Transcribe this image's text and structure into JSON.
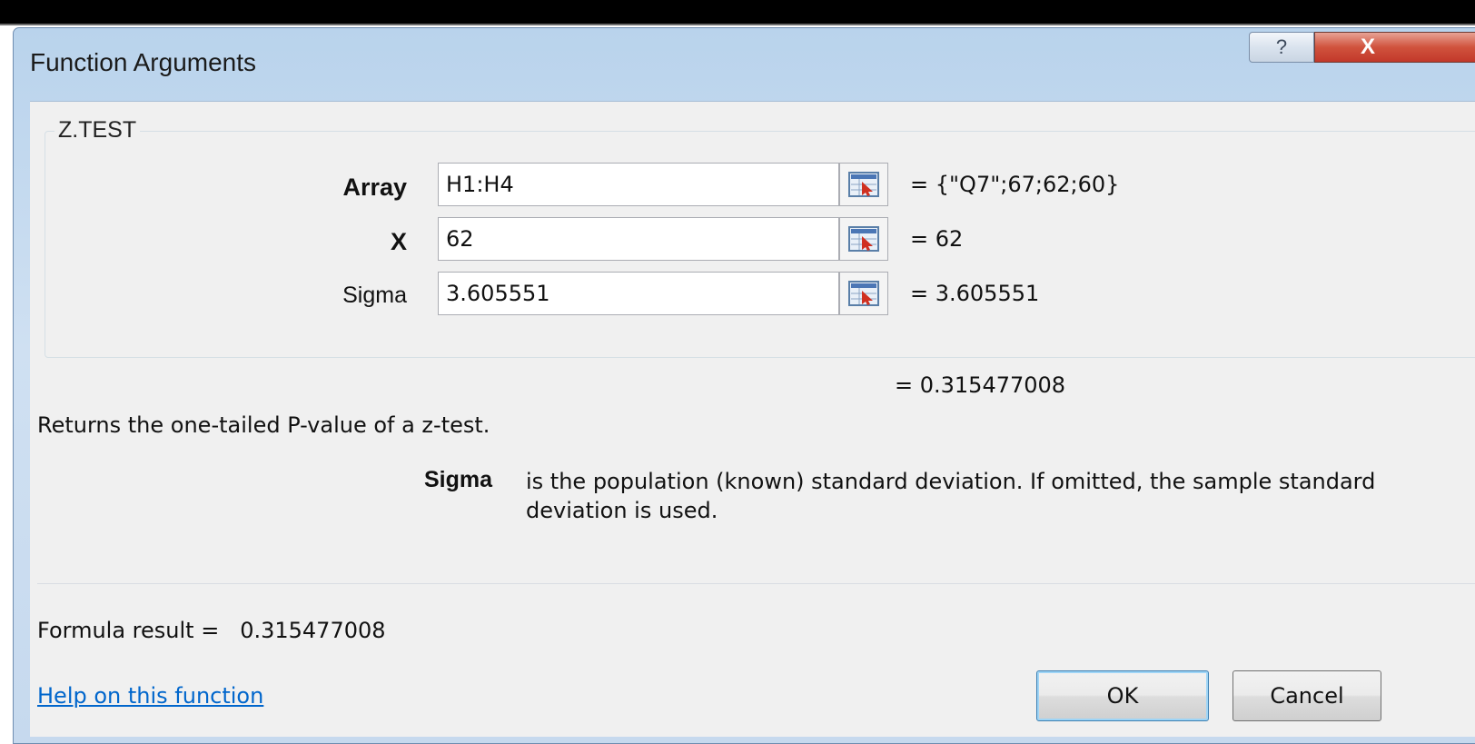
{
  "window": {
    "title": "Function Arguments",
    "help_button": "?",
    "close_button": "X"
  },
  "function": {
    "name": "Z.TEST",
    "description": "Returns the one-tailed P-value of a z-test."
  },
  "arguments": [
    {
      "label": "Array",
      "bold": true,
      "value": "H1:H4",
      "evaluated": "=  {\"Q7\";67;62;60}"
    },
    {
      "label": "X",
      "bold": true,
      "value": "62",
      "evaluated": "=  62"
    },
    {
      "label": "Sigma",
      "bold": false,
      "value": "3.605551",
      "evaluated": "=  3.605551"
    }
  ],
  "result_line": "=  0.315477008",
  "argument_help": {
    "name": "Sigma",
    "text": "is the population (known) standard deviation. If omitted, the sample standard deviation is used."
  },
  "formula_result": "Formula result =   0.315477008",
  "help_link": "Help on this function",
  "buttons": {
    "ok": "OK",
    "cancel": "Cancel"
  },
  "colors": {
    "title_gradient": "#cfe0f2",
    "close_red": "#c2382a",
    "link_blue": "#0066cc",
    "ok_focus": "#3c7fb1"
  }
}
